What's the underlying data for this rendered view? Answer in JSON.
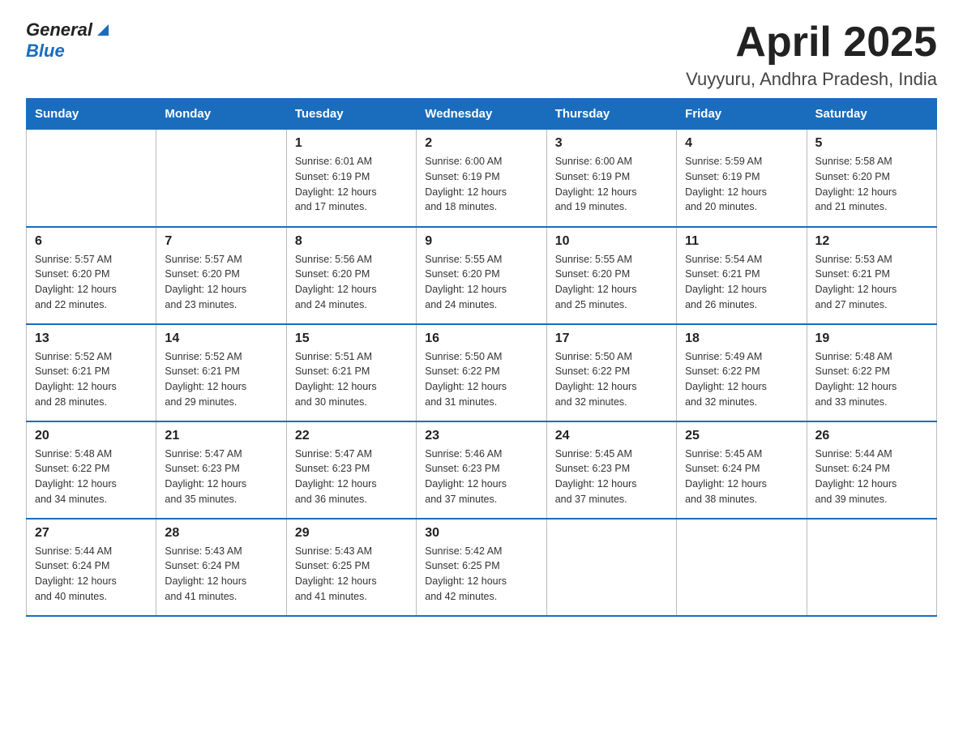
{
  "header": {
    "logo": {
      "general": "General",
      "blue": "Blue",
      "triangle": "▲"
    },
    "title": "April 2025",
    "location": "Vuyyuru, Andhra Pradesh, India"
  },
  "calendar": {
    "days_of_week": [
      "Sunday",
      "Monday",
      "Tuesday",
      "Wednesday",
      "Thursday",
      "Friday",
      "Saturday"
    ],
    "weeks": [
      [
        {
          "day": "",
          "info": ""
        },
        {
          "day": "",
          "info": ""
        },
        {
          "day": "1",
          "info": "Sunrise: 6:01 AM\nSunset: 6:19 PM\nDaylight: 12 hours\nand 17 minutes."
        },
        {
          "day": "2",
          "info": "Sunrise: 6:00 AM\nSunset: 6:19 PM\nDaylight: 12 hours\nand 18 minutes."
        },
        {
          "day": "3",
          "info": "Sunrise: 6:00 AM\nSunset: 6:19 PM\nDaylight: 12 hours\nand 19 minutes."
        },
        {
          "day": "4",
          "info": "Sunrise: 5:59 AM\nSunset: 6:19 PM\nDaylight: 12 hours\nand 20 minutes."
        },
        {
          "day": "5",
          "info": "Sunrise: 5:58 AM\nSunset: 6:20 PM\nDaylight: 12 hours\nand 21 minutes."
        }
      ],
      [
        {
          "day": "6",
          "info": "Sunrise: 5:57 AM\nSunset: 6:20 PM\nDaylight: 12 hours\nand 22 minutes."
        },
        {
          "day": "7",
          "info": "Sunrise: 5:57 AM\nSunset: 6:20 PM\nDaylight: 12 hours\nand 23 minutes."
        },
        {
          "day": "8",
          "info": "Sunrise: 5:56 AM\nSunset: 6:20 PM\nDaylight: 12 hours\nand 24 minutes."
        },
        {
          "day": "9",
          "info": "Sunrise: 5:55 AM\nSunset: 6:20 PM\nDaylight: 12 hours\nand 24 minutes."
        },
        {
          "day": "10",
          "info": "Sunrise: 5:55 AM\nSunset: 6:20 PM\nDaylight: 12 hours\nand 25 minutes."
        },
        {
          "day": "11",
          "info": "Sunrise: 5:54 AM\nSunset: 6:21 PM\nDaylight: 12 hours\nand 26 minutes."
        },
        {
          "day": "12",
          "info": "Sunrise: 5:53 AM\nSunset: 6:21 PM\nDaylight: 12 hours\nand 27 minutes."
        }
      ],
      [
        {
          "day": "13",
          "info": "Sunrise: 5:52 AM\nSunset: 6:21 PM\nDaylight: 12 hours\nand 28 minutes."
        },
        {
          "day": "14",
          "info": "Sunrise: 5:52 AM\nSunset: 6:21 PM\nDaylight: 12 hours\nand 29 minutes."
        },
        {
          "day": "15",
          "info": "Sunrise: 5:51 AM\nSunset: 6:21 PM\nDaylight: 12 hours\nand 30 minutes."
        },
        {
          "day": "16",
          "info": "Sunrise: 5:50 AM\nSunset: 6:22 PM\nDaylight: 12 hours\nand 31 minutes."
        },
        {
          "day": "17",
          "info": "Sunrise: 5:50 AM\nSunset: 6:22 PM\nDaylight: 12 hours\nand 32 minutes."
        },
        {
          "day": "18",
          "info": "Sunrise: 5:49 AM\nSunset: 6:22 PM\nDaylight: 12 hours\nand 32 minutes."
        },
        {
          "day": "19",
          "info": "Sunrise: 5:48 AM\nSunset: 6:22 PM\nDaylight: 12 hours\nand 33 minutes."
        }
      ],
      [
        {
          "day": "20",
          "info": "Sunrise: 5:48 AM\nSunset: 6:22 PM\nDaylight: 12 hours\nand 34 minutes."
        },
        {
          "day": "21",
          "info": "Sunrise: 5:47 AM\nSunset: 6:23 PM\nDaylight: 12 hours\nand 35 minutes."
        },
        {
          "day": "22",
          "info": "Sunrise: 5:47 AM\nSunset: 6:23 PM\nDaylight: 12 hours\nand 36 minutes."
        },
        {
          "day": "23",
          "info": "Sunrise: 5:46 AM\nSunset: 6:23 PM\nDaylight: 12 hours\nand 37 minutes."
        },
        {
          "day": "24",
          "info": "Sunrise: 5:45 AM\nSunset: 6:23 PM\nDaylight: 12 hours\nand 37 minutes."
        },
        {
          "day": "25",
          "info": "Sunrise: 5:45 AM\nSunset: 6:24 PM\nDaylight: 12 hours\nand 38 minutes."
        },
        {
          "day": "26",
          "info": "Sunrise: 5:44 AM\nSunset: 6:24 PM\nDaylight: 12 hours\nand 39 minutes."
        }
      ],
      [
        {
          "day": "27",
          "info": "Sunrise: 5:44 AM\nSunset: 6:24 PM\nDaylight: 12 hours\nand 40 minutes."
        },
        {
          "day": "28",
          "info": "Sunrise: 5:43 AM\nSunset: 6:24 PM\nDaylight: 12 hours\nand 41 minutes."
        },
        {
          "day": "29",
          "info": "Sunrise: 5:43 AM\nSunset: 6:25 PM\nDaylight: 12 hours\nand 41 minutes."
        },
        {
          "day": "30",
          "info": "Sunrise: 5:42 AM\nSunset: 6:25 PM\nDaylight: 12 hours\nand 42 minutes."
        },
        {
          "day": "",
          "info": ""
        },
        {
          "day": "",
          "info": ""
        },
        {
          "day": "",
          "info": ""
        }
      ]
    ]
  }
}
